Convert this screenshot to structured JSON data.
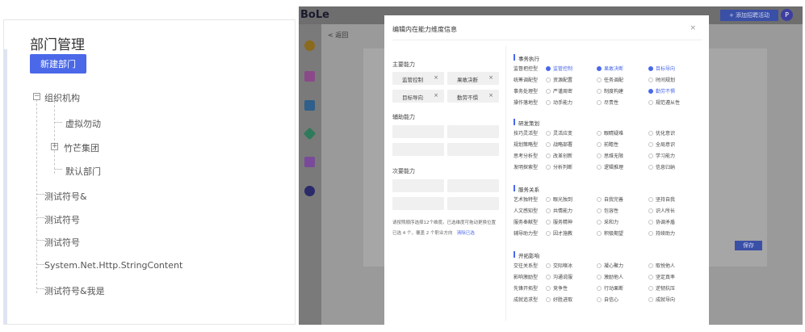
{
  "department": {
    "title": "部门管理",
    "new_button": "新建部门",
    "tree": {
      "root": "组织机构",
      "children": [
        "虚拟勿动",
        "竹芒集团",
        "默认部门"
      ]
    },
    "items": [
      "测试符号&",
      "测试符号",
      "测试符号",
      "System.Net.Http.StringContent",
      "测试符号&我是"
    ]
  },
  "app": {
    "brand": "BoLe",
    "add_button": "+ 添加招聘活动",
    "avatar": "P",
    "back": "< 返回",
    "save": "保存"
  },
  "modal": {
    "title": "编辑内在能力维度信息",
    "close": "×",
    "primary_label": "主要能力",
    "primary_tags": [
      {
        "label": "监管控制",
        "x": "×"
      },
      {
        "label": "果敢决断",
        "x": "×"
      },
      {
        "label": "目标导向",
        "x": "×"
      },
      {
        "label": "勤劳不惧",
        "x": "×"
      }
    ],
    "secondary_label": "辅助能力",
    "tertiary_label": "次要能力",
    "hint_line1": "请按照顺序选择12个维度。已选维度可拖动更换位置",
    "hint_line2": "已选 4 个，覆盖 2 个职业方向",
    "hint_clear": "清除已选",
    "categories": [
      {
        "name": "事务执行",
        "rows": [
          {
            "label": "监督把控型",
            "options": [
              {
                "text": "监管控制",
                "checked": true
              },
              {
                "text": "果敢决断",
                "checked": true
              },
              {
                "text": "目标导向",
                "checked": true
              }
            ]
          },
          {
            "label": "统筹调配型",
            "options": [
              {
                "text": "资源配置",
                "checked": false
              },
              {
                "text": "任务调配",
                "checked": false
              },
              {
                "text": "时间规划",
                "checked": false
              }
            ]
          },
          {
            "label": "事务处理型",
            "options": [
              {
                "text": "严谨周密",
                "checked": false
              },
              {
                "text": "制度构建",
                "checked": false
              },
              {
                "text": "勤劳不惧",
                "checked": true
              }
            ]
          },
          {
            "label": "操作落地型",
            "options": [
              {
                "text": "动手能力",
                "checked": false
              },
              {
                "text": "尽责性",
                "checked": false
              },
              {
                "text": "规范遵从性",
                "checked": false
              }
            ]
          }
        ]
      },
      {
        "name": "研发策划",
        "rows": [
          {
            "label": "技巧灵活型",
            "options": [
              {
                "text": "灵活应变",
                "checked": false
              },
              {
                "text": "眼睛疑难",
                "checked": false
              },
              {
                "text": "优化意识",
                "checked": false
              }
            ]
          },
          {
            "label": "规划策略型",
            "options": [
              {
                "text": "战略部署",
                "checked": false
              },
              {
                "text": "前瞻性",
                "checked": false
              },
              {
                "text": "全局意识",
                "checked": false
              }
            ]
          },
          {
            "label": "思考分析型",
            "options": [
              {
                "text": "改革创新",
                "checked": false
              },
              {
                "text": "思维无限",
                "checked": false
              },
              {
                "text": "学习能力",
                "checked": false
              }
            ]
          },
          {
            "label": "发明探索型",
            "options": [
              {
                "text": "分析判断",
                "checked": false
              },
              {
                "text": "逻辑推理",
                "checked": false
              },
              {
                "text": "信息归纳",
                "checked": false
              }
            ]
          }
        ]
      },
      {
        "name": "服务关系",
        "rows": [
          {
            "label": "艺术独特型",
            "options": [
              {
                "text": "眼光独到",
                "checked": false
              },
              {
                "text": "自我完善",
                "checked": false
              },
              {
                "text": "坚持自我",
                "checked": false
              }
            ]
          },
          {
            "label": "人文感知型",
            "options": [
              {
                "text": "共情能力",
                "checked": false
              },
              {
                "text": "包容性",
                "checked": false
              },
              {
                "text": "识人所长",
                "checked": false
              }
            ]
          },
          {
            "label": "服务奉献型",
            "options": [
              {
                "text": "服务精神",
                "checked": false
              },
              {
                "text": "采和力",
                "checked": false
              },
              {
                "text": "协调矛盾",
                "checked": false
              }
            ]
          },
          {
            "label": "辅导助力型",
            "options": [
              {
                "text": "因才施教",
                "checked": false
              },
              {
                "text": "积极期望",
                "checked": false
              },
              {
                "text": "持续助力",
                "checked": false
              }
            ]
          }
        ]
      },
      {
        "name": "开拓影响",
        "rows": [
          {
            "label": "交往关系型",
            "options": [
              {
                "text": "交际嗅冰",
                "checked": false
              },
              {
                "text": "凝心聚力",
                "checked": false
              },
              {
                "text": "取悦他人",
                "checked": false
              }
            ]
          },
          {
            "label": "影响激励型",
            "options": [
              {
                "text": "沟通说服",
                "checked": false
              },
              {
                "text": "激励他人",
                "checked": false
              },
              {
                "text": "坚定真率",
                "checked": false
              }
            ]
          },
          {
            "label": "先锋开拓型",
            "options": [
              {
                "text": "竞争性",
                "checked": false
              },
              {
                "text": "行动果断",
                "checked": false
              },
              {
                "text": "逆韧抗压",
                "checked": false
              }
            ]
          },
          {
            "label": "成就追求型",
            "options": [
              {
                "text": "好胜进取",
                "checked": false
              },
              {
                "text": "自信心",
                "checked": false
              },
              {
                "text": "成就导向",
                "checked": false
              }
            ]
          }
        ]
      }
    ]
  }
}
